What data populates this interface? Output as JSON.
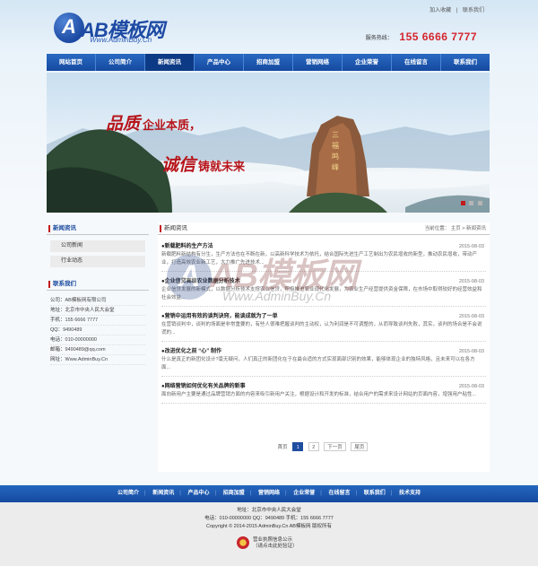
{
  "header": {
    "logo_mark": "A",
    "logo_text": "AB模板网",
    "logo_url": "Www.AdminBuy.Cn",
    "top_links": [
      "加入收藏",
      "联系我们"
    ],
    "hotline_label": "服务热线：",
    "hotline_number": "155 6666 7777"
  },
  "nav": {
    "items": [
      "网站首页",
      "公司简介",
      "新闻资讯",
      "产品中心",
      "招商加盟",
      "营销网络",
      "企业荣誉",
      "在线留言",
      "联系我们"
    ],
    "active_index": 2
  },
  "banner": {
    "slogan_a_big": "品质",
    "slogan_a_small": "企业本质，",
    "slogan_b_big": "诚信",
    "slogan_b_small": "铸就未来",
    "slide_count": 3,
    "active_slide": 0
  },
  "sidebar": {
    "category_title": "新闻资讯",
    "categories": [
      "公司新闻",
      "行业动态"
    ],
    "contact_title": "联系我们",
    "contact": [
      {
        "k": "公司：",
        "v": "AB模板网有限公司"
      },
      {
        "k": "地址：",
        "v": "北京市中央人民大会堂"
      },
      {
        "k": "手机：",
        "v": "155 6666 7777"
      },
      {
        "k": "QQ：",
        "v": "9490489"
      },
      {
        "k": "电话：",
        "v": "010-00000000"
      },
      {
        "k": "邮箱：",
        "v": "9490489@qq.com"
      },
      {
        "k": "网址：",
        "v": "Www.AdminBuy.Cn"
      }
    ]
  },
  "main": {
    "title": "新闻资讯",
    "breadcrumb": "当前位置： 主页  >  新闻资讯",
    "news": [
      {
        "title": "●新载肥料的生产方法",
        "date": "2015-08-03",
        "body": "新载肥料新结构有分生，生产方法也在不断在新，以高新科学技术为依托，结合国际先进生产工艺制出为农民增收的新型，推动农民增收，带动产业，打造高效农业新工艺，大力推广先进技术..."
      },
      {
        "title": "●企业信贷高级农业数据分析技术",
        "date": "2015-08-03",
        "body": "企业信贷发展的新模式，以数据分析技术支撑农业信贷，积极推进农业现代化发展，为农业生产经营提供资金保障，在市场中取得较好的经营效益和社会效益..."
      },
      {
        "title": "●营销中运用有效的谈判诀窍，能谈成就为了一单",
        "date": "2015-08-03",
        "body": "在营销谈判中，谈判的场面是非常重要的，有些人很难把握谈判的主动权，认为利润是不可调整的，从而导致谈判失败，其实，谈判的场合是不会说谎的..."
      },
      {
        "title": "●改进优化之前 “心” 制作",
        "date": "2015-08-03",
        "body": "什么是真正的新团化设计?毫无疑问，人们真正的新团化在于在最合适的方式实现面部识别的效果，能够体现企业的独特风格，且未来可以在各方面..."
      },
      {
        "title": "●网络营销如何优化有关品牌的新事",
        "date": "2015-08-03",
        "body": "面向新用户主要是通过品牌营销方面的内容来吸引新用户关注，根据设计和开发的标准，结合用户的需求来设计网站的页面内容，增强用户粘性..."
      }
    ],
    "pager": {
      "label": "首页",
      "pages": [
        "1",
        "2"
      ],
      "current": "1",
      "next": "下一页",
      "last": "尾页"
    }
  },
  "watermark": {
    "mark": "A",
    "text": "AB模板网",
    "url": "Www.AdminBuy.Cn"
  },
  "footer": {
    "nav": [
      "公司简介",
      "新闻资讯",
      "产品中心",
      "招商加盟",
      "营销网络",
      "企业荣誉",
      "在线留言",
      "联系我们",
      "技术支持"
    ],
    "address": "地址：北京市中央人民大会堂",
    "contact_line": "电话：010-00000000  QQ：9490489  手机：155 6666 7777",
    "copyright": "Copyright © 2014-2015 AdminBuy.Cn  AB模板网  版权所有",
    "license_line1": "营业执照信息公示",
    "license_line2": "（请点击此处验证）"
  },
  "colors": {
    "brand_blue": "#1e4da0",
    "accent_red": "#c21a1a",
    "hotline_red": "#d4252e"
  }
}
